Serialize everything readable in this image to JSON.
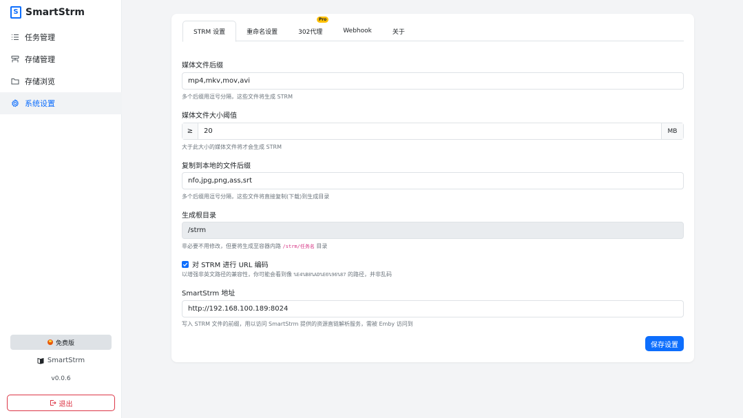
{
  "brand": {
    "name": "SmartStrm",
    "logo_text": "S"
  },
  "nav": [
    {
      "label": "任务管理",
      "icon": "list-icon",
      "active": false
    },
    {
      "label": "存储管理",
      "icon": "storage-icon",
      "active": false
    },
    {
      "label": "存储浏览",
      "icon": "folder-icon",
      "active": false
    },
    {
      "label": "系统设置",
      "icon": "gear-icon",
      "active": true
    }
  ],
  "sidebar_footer": {
    "edition_label": "免费版",
    "repo_label": "SmartStrm",
    "version": "v0.0.6",
    "logout_label": "退出"
  },
  "tabs": [
    {
      "label": "STRM 设置",
      "active": true
    },
    {
      "label": "重命名设置",
      "active": false
    },
    {
      "label": "302代理",
      "active": false,
      "badge": "Pro"
    },
    {
      "label": "Webhook",
      "active": false
    },
    {
      "label": "关于",
      "active": false
    }
  ],
  "form": {
    "media_ext": {
      "label": "媒体文件后缀",
      "value": "mp4,mkv,mov,avi",
      "help": "多个后缀用逗号分隔，这些文件将生成 STRM"
    },
    "size_threshold": {
      "label": "媒体文件大小阈值",
      "prefix": "≥",
      "value": "20",
      "unit": "MB",
      "help": "大于此大小的媒体文件将才会生成 STRM"
    },
    "copy_ext": {
      "label": "复制到本地的文件后缀",
      "value": "nfo,jpg,png,ass,srt",
      "help": "多个后缀用逗号分隔，这些文件将直接复制(下载)到生成目录"
    },
    "root_dir": {
      "label": "生成根目录",
      "value": "/strm",
      "help_before": "非必要不用修改，但要将生成至容器内路",
      "help_code": "/strm/任务名",
      "help_after": " 目录"
    },
    "url_encode": {
      "label": "对 STRM 进行 URL 编码",
      "checked": true,
      "help_before": "以增强非英文路径的兼容性，你可能会看到像 ",
      "help_code": "%E4%B8%AD%E6%96%87",
      "help_after": " 的路径，并非乱码"
    },
    "address": {
      "label": "SmartStrm 地址",
      "value": "http://192.168.100.189:8024",
      "help": "写入 STRM 文件的前缀，用以访问 SmartStrm 提供的资源直链解析服务，需被 Emby 访问到"
    },
    "save_label": "保存设置"
  },
  "colors": {
    "accent": "#0d6efd",
    "danger": "#dc3545",
    "badge": "#ffc107"
  }
}
